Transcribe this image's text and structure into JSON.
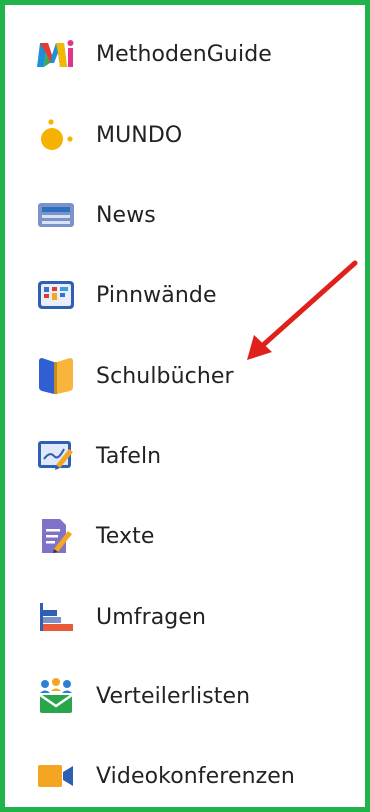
{
  "menu": {
    "items": [
      {
        "label": "MethodenGuide",
        "icon": "methodenguide-logo-icon"
      },
      {
        "label": "MUNDO",
        "icon": "mundo-logo-icon"
      },
      {
        "label": "News",
        "icon": "news-icon"
      },
      {
        "label": "Pinnwände",
        "icon": "pinboard-icon"
      },
      {
        "label": "Schulbücher",
        "icon": "schoolbook-icon"
      },
      {
        "label": "Tafeln",
        "icon": "whiteboard-icon"
      },
      {
        "label": "Texte",
        "icon": "text-document-icon"
      },
      {
        "label": "Umfragen",
        "icon": "survey-chart-icon"
      },
      {
        "label": "Verteilerlisten",
        "icon": "distribution-list-icon"
      },
      {
        "label": "Videokonferenzen",
        "icon": "video-camera-icon"
      }
    ]
  },
  "colors": {
    "frame_border": "#1fb34a",
    "annotation_arrow": "#e0201b",
    "text": "#222222"
  }
}
